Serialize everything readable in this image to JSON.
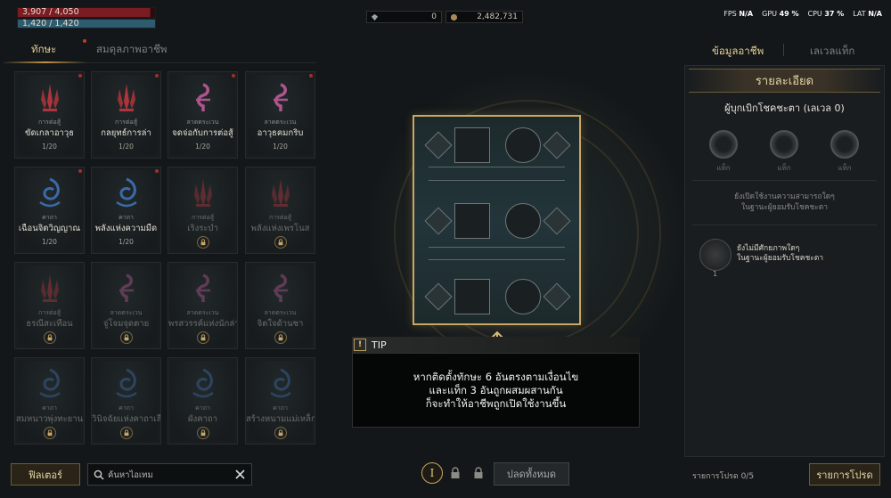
{
  "status": {
    "hp": "3,907 / 4,050",
    "mp": "1,420 / 1,420",
    "hp_fraction": 0.965,
    "mp_fraction": 1.0
  },
  "currency": {
    "gems": "0",
    "gold": "2,482,731"
  },
  "perf": {
    "fps_label": "FPS",
    "fps_value": "N/A",
    "gpu_label": "GPU",
    "gpu_value": "49 %",
    "cpu_label": "CPU",
    "cpu_value": "37 %",
    "lat_label": "LAT",
    "lat_value": "N/A"
  },
  "left_tabs": {
    "skills": "ทักษะ",
    "profession_stats": "สมดุลภาพอาชีพ"
  },
  "skills": [
    {
      "category": "การต่อสู้",
      "name": "ขัดเกลาอาวุธ",
      "level": "1/20",
      "locked": false,
      "type": "combat",
      "dot": true
    },
    {
      "category": "การต่อสู้",
      "name": "กลยุทธ์การล่า",
      "level": "1/20",
      "locked": false,
      "type": "combat",
      "dot": true
    },
    {
      "category": "ลาดตระเวน",
      "name": "จดจ่อกับการต่อสู้",
      "level": "1/20",
      "locked": false,
      "type": "scout",
      "dot": true
    },
    {
      "category": "ลาดตระเวน",
      "name": "อาวุธคมกริบ",
      "level": "1/20",
      "locked": false,
      "type": "scout",
      "dot": true
    },
    {
      "category": "คาถา",
      "name": "เฉือนจิตวิญญาณ",
      "level": "1/20",
      "locked": false,
      "type": "spell",
      "dot": true
    },
    {
      "category": "คาถา",
      "name": "พลังแห่งความมืด",
      "level": "1/20",
      "locked": false,
      "type": "spell",
      "dot": true
    },
    {
      "category": "การต่อสู้",
      "name": "เริงระบำ",
      "level": "",
      "locked": true,
      "type": "combat",
      "dot": false
    },
    {
      "category": "การต่อสู้",
      "name": "พลังแห่งเพรโนส",
      "level": "",
      "locked": true,
      "type": "combat",
      "dot": false
    },
    {
      "category": "การต่อสู้",
      "name": "ธรณีสะเทือน",
      "level": "",
      "locked": true,
      "type": "combat",
      "dot": false
    },
    {
      "category": "ลาดตระเวน",
      "name": "จู่โจมจุดตาย",
      "level": "",
      "locked": true,
      "type": "scout",
      "dot": false
    },
    {
      "category": "ลาดตระเวน",
      "name": "พรสวรรค์แห่งนักล่า",
      "level": "",
      "locked": true,
      "type": "scout",
      "dot": false
    },
    {
      "category": "ลาดตระเวน",
      "name": "จิตใจด้านชา",
      "level": "",
      "locked": true,
      "type": "scout",
      "dot": false
    },
    {
      "category": "คาถา",
      "name": "สมหนาวพุ่งทะยาน",
      "level": "",
      "locked": true,
      "type": "spell",
      "dot": false
    },
    {
      "category": "คาถา",
      "name": "วินิจฉัยแห่งคาถาเลือน",
      "level": "",
      "locked": true,
      "type": "spell",
      "dot": false
    },
    {
      "category": "คาถา",
      "name": "ผังคาถา",
      "level": "",
      "locked": true,
      "type": "spell",
      "dot": false
    },
    {
      "category": "คาถา",
      "name": "สร้างหนามแม่เหล็ก",
      "level": "",
      "locked": true,
      "type": "spell",
      "dot": false
    }
  ],
  "tip": {
    "title": "TIP",
    "line1": "หากติดตั้งทักษะ 6 อันตรงตามเงื่อนไข",
    "line2": "และแท็ก 3 อันถูกผสมผสานกัน",
    "line3": "ก็จะทำให้อาชีพถูกเปิดใช้งานขึ้น"
  },
  "right_tabs": {
    "profession_info": "ข้อมูลอาชีพ",
    "tag_level": "เลเวลแท็ก"
  },
  "details": {
    "header": "รายละเอียด",
    "subtitle": "ผู้บุกเบิกโชคชะตา (เลเวล 0)",
    "tag_labels": [
      "แท็ก",
      "แท็ก",
      "แท็ก"
    ],
    "note_line1": "ยังเปิดใช้งานความสามารถใดๆ",
    "note_line2": "ในฐานะผู้ยอมรับโชคชะตา",
    "badge_line1": "ยังไม่มีศักยภาพใดๆ",
    "badge_line2": "ในฐานะผู้ยอมรับโชคชะตา",
    "badge_number": "1"
  },
  "bottom": {
    "filter": "ฟิลเตอร์",
    "search_placeholder": "ค้นหาไอเทม",
    "page_label": "I",
    "reset_all": "ปลดทั้งหมด",
    "procs_count": "รายการโปรด 0/5",
    "procs": "รายการโปรด"
  },
  "colors": {
    "accent_gold": "#c9a661",
    "hp": "#7a1c22",
    "mp": "#2e5c6e",
    "combat": "#b0343b",
    "scout": "#b0548f",
    "spell": "#3c6aa8"
  }
}
